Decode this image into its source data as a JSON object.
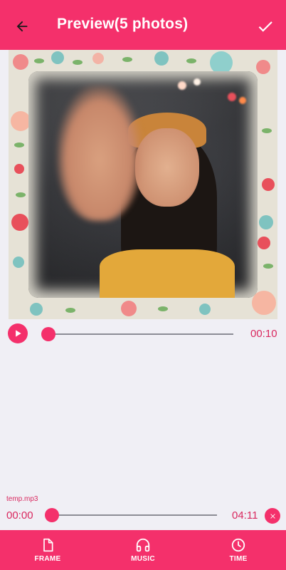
{
  "header": {
    "title": "Preview(5 photos)",
    "back_icon": "arrow-left-icon",
    "confirm_icon": "check-icon"
  },
  "colors": {
    "accent": "#f4306b",
    "accent_text": "#d9285f",
    "background": "#f0eff5"
  },
  "preview_player": {
    "play_icon": "play-icon",
    "progress": 0,
    "duration": "00:10"
  },
  "music": {
    "file_name": "temp.mp3",
    "current_time": "00:00",
    "total_time": "04:11",
    "progress": 0,
    "remove_icon": "close-icon"
  },
  "bottom_nav": {
    "items": [
      {
        "label": "FRAME",
        "icon": "file-icon"
      },
      {
        "label": "MUSIC",
        "icon": "headphones-icon"
      },
      {
        "label": "TIME",
        "icon": "clock-icon"
      }
    ]
  }
}
